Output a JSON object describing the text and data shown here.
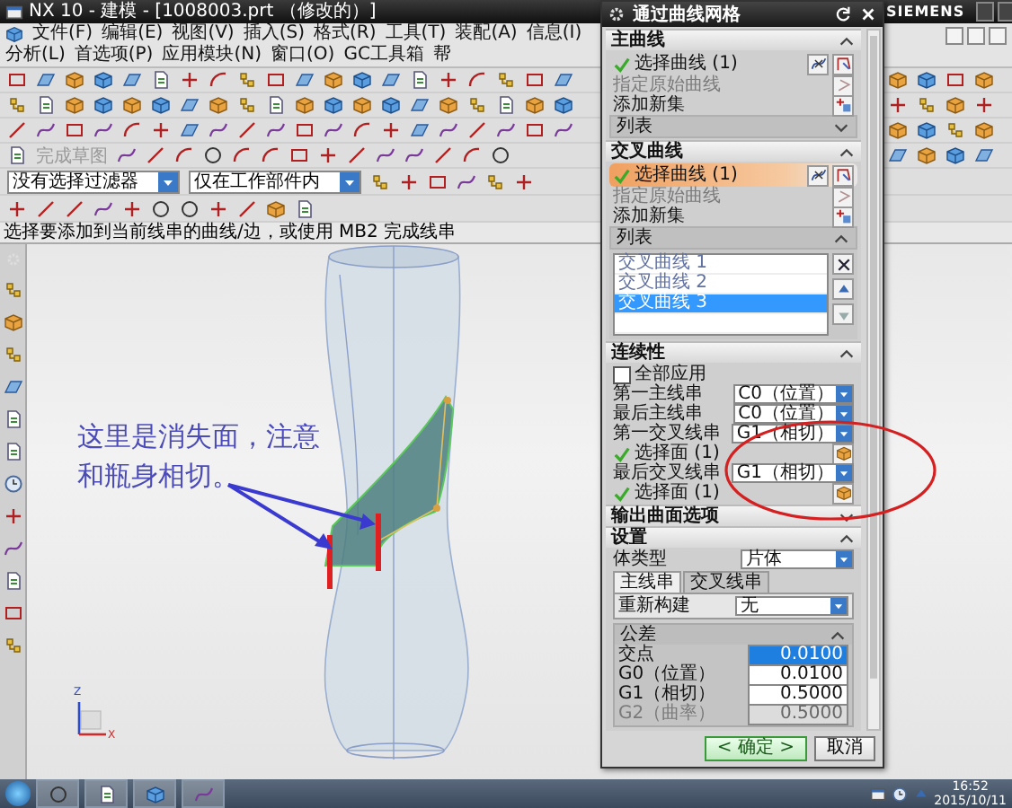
{
  "window": {
    "title": "NX 10 - 建模 - [1008003.prt （修改的）]",
    "brand": "SIEMENS"
  },
  "menu": [
    "文件(F)",
    "编辑(E)",
    "视图(V)",
    "插入(S)",
    "格式(R)",
    "工具(T)",
    "装配(A)",
    "信息(I)",
    "分析(L)",
    "首选项(P)",
    "应用模块(N)",
    "窗口(O)",
    "GC工具箱",
    "帮"
  ],
  "toolbar": {
    "finish_sketch": {
      "label": "完成草图",
      "disabled": true
    },
    "filters": [
      "没有选择过滤器",
      "仅在工作部件内"
    ]
  },
  "prompt": "选择要添加到当前线串的曲线/边，或使用 MB2 完成线串",
  "viewport": {
    "annotation": "这里是消失面，注意和瓶身相切。",
    "axis_labels": [
      "Z",
      "X"
    ]
  },
  "dialog": {
    "title": "通过曲线网格",
    "sections": [
      {
        "title": "主曲线",
        "expanded": true,
        "rows": [
          {
            "kind": "select",
            "label": "选择曲线 (1)",
            "done": true,
            "selected": false
          },
          {
            "kind": "specify",
            "label": "指定原始曲线",
            "disabled": true
          },
          {
            "kind": "add",
            "label": "添加新集"
          },
          {
            "kind": "list",
            "title": "列表",
            "expanded": false
          }
        ]
      },
      {
        "title": "交叉曲线",
        "expanded": true,
        "rows": [
          {
            "kind": "select",
            "label": "选择曲线 (1)",
            "done": true,
            "selected": true
          },
          {
            "kind": "specify",
            "label": "指定原始曲线",
            "disabled": true
          },
          {
            "kind": "add",
            "label": "添加新集"
          },
          {
            "kind": "list",
            "title": "列表",
            "expanded": true,
            "items": [
              {
                "label": "交叉曲线 1",
                "selected": false
              },
              {
                "label": "交叉曲线 2",
                "selected": false
              },
              {
                "label": "交叉曲线 3",
                "selected": true
              }
            ]
          }
        ]
      },
      {
        "title": "连续性",
        "expanded": true,
        "rows": [
          {
            "kind": "checkbox",
            "label": "全部应用",
            "checked": false
          },
          {
            "kind": "dropdown",
            "label": "第一主线串",
            "value": "C0（位置）"
          },
          {
            "kind": "dropdown",
            "label": "最后主线串",
            "value": "C0（位置）"
          },
          {
            "kind": "dropdown",
            "label": "第一交叉线串",
            "value": "G1（相切）"
          },
          {
            "kind": "face",
            "label": "选择面 (1)",
            "done": true
          },
          {
            "kind": "dropdown",
            "label": "最后交叉线串",
            "value": "G1（相切）"
          },
          {
            "kind": "face",
            "label": "选择面 (1)",
            "done": true
          }
        ]
      },
      {
        "title": "输出曲面选项",
        "expanded": false
      },
      {
        "title": "设置",
        "expanded": true,
        "rows": [
          {
            "kind": "dropdown",
            "label": "体类型",
            "value": "片体"
          },
          {
            "kind": "tabs",
            "tabs": [
              {
                "label": "主线串",
                "selected": true
              },
              {
                "label": "交叉线串",
                "selected": false
              }
            ],
            "rows": [
              {
                "kind": "dropdown",
                "label": "重新构建",
                "value": "无"
              }
            ]
          },
          {
            "kind": "group",
            "title": "公差",
            "expanded": true,
            "rows": [
              {
                "kind": "number",
                "label": "交点",
                "value": "0.0100",
                "selected": true,
                "disabled": false
              },
              {
                "kind": "number",
                "label": "G0（位置）",
                "value": "0.0100",
                "selected": false,
                "disabled": false
              },
              {
                "kind": "number",
                "label": "G1（相切）",
                "value": "0.5000",
                "selected": false,
                "disabled": false
              },
              {
                "kind": "number",
                "label": "G2（曲率）",
                "value": "0.5000",
                "selected": false,
                "disabled": true
              }
            ]
          }
        ]
      }
    ],
    "buttons": [
      {
        "label": "< 确定 >",
        "default": true
      },
      {
        "label": "取消",
        "default": false
      }
    ]
  },
  "taskbar": {
    "time": "16:52",
    "date": "2015/10/11"
  }
}
